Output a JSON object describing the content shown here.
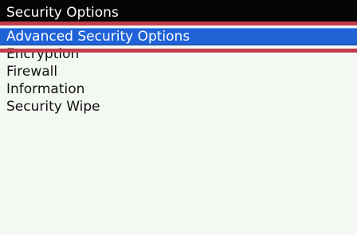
{
  "title_bar": {
    "title": "Security Options"
  },
  "menu": {
    "items": [
      {
        "label": "Advanced Security Options",
        "selected": true
      },
      {
        "label": "Encryption",
        "selected": false
      },
      {
        "label": "Firewall",
        "selected": false
      },
      {
        "label": "Information",
        "selected": false
      },
      {
        "label": "Security Wipe",
        "selected": false
      }
    ]
  },
  "colors": {
    "title_background": "#050505",
    "selection_background": "#1f63d7",
    "page_background": "#f4f8f2",
    "annotation": "#c43d4d"
  }
}
